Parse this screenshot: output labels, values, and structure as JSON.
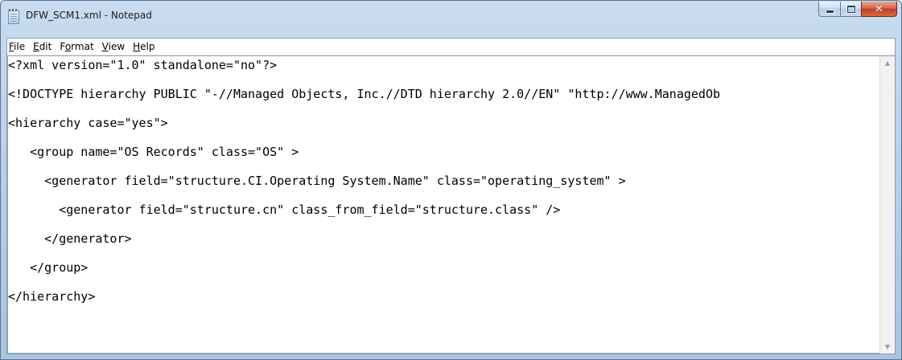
{
  "window": {
    "title": "DFW_SCM1.xml - Notepad",
    "buttons": {
      "minimize": "minimize",
      "maximize": "maximize",
      "close": "✕"
    }
  },
  "menu": [
    {
      "id": "file",
      "mnemonic": "F",
      "rest": "ile"
    },
    {
      "id": "edit",
      "mnemonic": "E",
      "rest": "dit"
    },
    {
      "id": "format",
      "pre": "F",
      "mnemonic": "o",
      "rest": "rmat"
    },
    {
      "id": "view",
      "mnemonic": "V",
      "rest": "iew"
    },
    {
      "id": "help",
      "mnemonic": "H",
      "rest": "elp"
    }
  ],
  "document": {
    "lines": [
      "<?xml version=\"1.0\" standalone=\"no\"?>",
      "<!DOCTYPE hierarchy PUBLIC \"-//Managed Objects, Inc.//DTD hierarchy 2.0//EN\" \"http://www.ManagedOb",
      "<hierarchy case=\"yes\">",
      "   <group name=\"OS Records\" class=\"OS\" >",
      "     <generator field=\"structure.CI.Operating System.Name\" class=\"operating_system\" >",
      "       <generator field=\"structure.cn\" class_from_field=\"structure.class\" />",
      "     </generator>",
      "   </group>",
      "</hierarchy>"
    ]
  },
  "scrollbar": {
    "up_icon": "scroll-up-arrow",
    "down_icon": "scroll-down-arrow"
  }
}
